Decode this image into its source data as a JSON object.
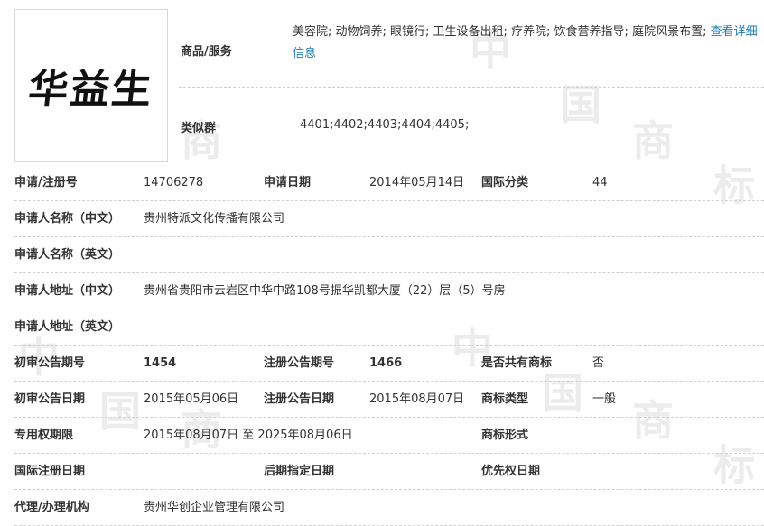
{
  "logo": {
    "text": "华益生"
  },
  "goods": {
    "label": "商品/服务",
    "value": "美容院; 动物饲养; 眼镜行; 卫生设备出租; 疗养院; 饮食营养指导; 庭院风景布置;",
    "link": "查看详细信息"
  },
  "similar_group": {
    "label": "类似群",
    "value": "4401;4402;4403;4404;4405;"
  },
  "rows": {
    "reg": {
      "label": "申请/注册号",
      "value": "14706278",
      "date_label": "申请日期",
      "date_value": "2014年05月14日",
      "class_label": "国际分类",
      "class_value": "44"
    },
    "name_cn": {
      "label": "申请人名称（中文）",
      "value": "贵州特派文化传播有限公司"
    },
    "name_en": {
      "label": "申请人名称（英文）",
      "value": ""
    },
    "addr_cn": {
      "label": "申请人地址（中文）",
      "value": "贵州省贵阳市云岩区中华中路108号振华凯都大厦（22）层（5）号房"
    },
    "addr_en": {
      "label": "申请人地址（英文）",
      "value": ""
    },
    "pub_issue": {
      "label": "初审公告期号",
      "value": "1454",
      "reg_label": "注册公告期号",
      "reg_value": "1466",
      "shared_label": "是否共有商标",
      "shared_value": "否"
    },
    "pub_date": {
      "label": "初审公告日期",
      "value": "2015年05月06日",
      "reg_label": "注册公告日期",
      "reg_value": "2015年08月07日",
      "type_label": "商标类型",
      "type_value": "一般"
    },
    "term": {
      "label": "专用权期限",
      "value": "2015年08月07日 至 2025年08月06日",
      "form_label": "商标形式",
      "form_value": ""
    },
    "intl": {
      "label": "国际注册日期",
      "value": "",
      "later_label": "后期指定日期",
      "later_value": "",
      "prio_label": "优先权日期",
      "prio_value": ""
    },
    "agent": {
      "label": "代理/办理机构",
      "value": "贵州华创企业管理有限公司"
    }
  },
  "watermark": {
    "chars": [
      "中",
      "国",
      "商",
      "标"
    ]
  }
}
